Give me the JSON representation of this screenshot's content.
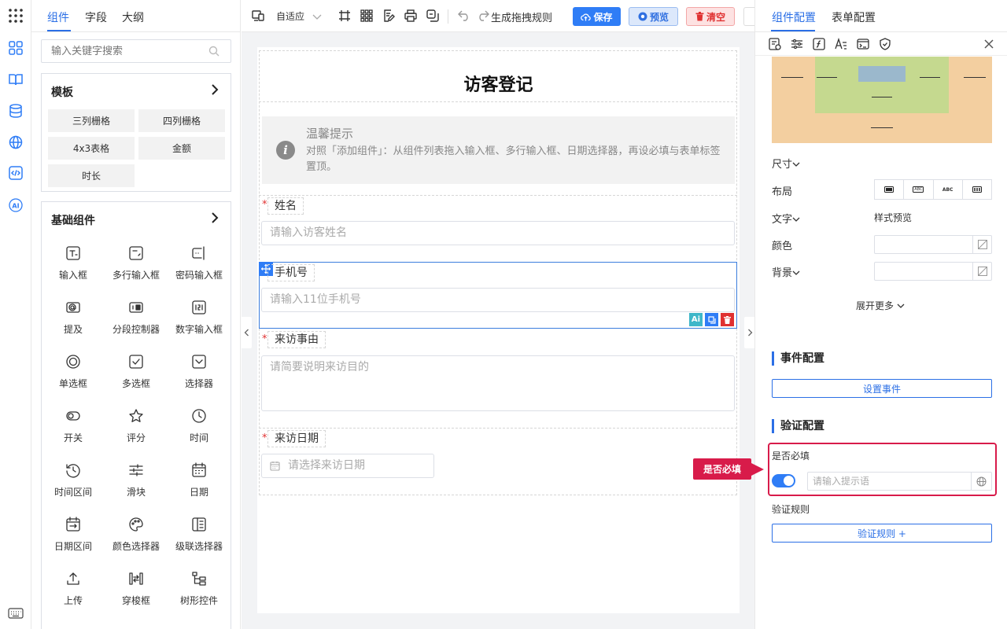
{
  "left_panel": {
    "tabs": [
      "组件",
      "字段",
      "大纲"
    ],
    "search_placeholder": "输入关键字搜索",
    "template_card": {
      "title": "模板",
      "items": [
        "三列栅格",
        "四列栅格",
        "4x3表格",
        "金额",
        "时长"
      ]
    },
    "basic_card": {
      "title": "基础组件",
      "items": [
        {
          "label": "输入框",
          "icon": "text-input-icon"
        },
        {
          "label": "多行输入框",
          "icon": "textarea-icon"
        },
        {
          "label": "密码输入框",
          "icon": "password-icon"
        },
        {
          "label": "提及",
          "icon": "mention-icon"
        },
        {
          "label": "分段控制器",
          "icon": "segmented-icon"
        },
        {
          "label": "数字输入框",
          "icon": "number-input-icon"
        },
        {
          "label": "单选框",
          "icon": "radio-icon"
        },
        {
          "label": "多选框",
          "icon": "checkbox-icon"
        },
        {
          "label": "选择器",
          "icon": "select-icon"
        },
        {
          "label": "开关",
          "icon": "switch-icon"
        },
        {
          "label": "评分",
          "icon": "star-icon"
        },
        {
          "label": "时间",
          "icon": "clock-icon"
        },
        {
          "label": "时间区间",
          "icon": "time-range-icon"
        },
        {
          "label": "滑块",
          "icon": "slider-icon"
        },
        {
          "label": "日期",
          "icon": "calendar-icon"
        },
        {
          "label": "日期区间",
          "icon": "date-range-icon"
        },
        {
          "label": "颜色选择器",
          "icon": "palette-icon"
        },
        {
          "label": "级联选择器",
          "icon": "cascader-icon"
        },
        {
          "label": "上传",
          "icon": "upload-icon"
        },
        {
          "label": "穿梭框",
          "icon": "transfer-icon"
        },
        {
          "label": "树形控件",
          "icon": "tree-icon"
        }
      ]
    }
  },
  "toolbar": {
    "device_label": "自适应",
    "generate_label": "生成拖拽规则",
    "save_label": "保存",
    "preview_label": "预览",
    "clear_label": "清空"
  },
  "form": {
    "title": "访客登记",
    "tip_title": "温馨提示",
    "tip_body": "对照「添加组件」：从组件列表拖入输入框、多行输入框、日期选择器，再设必填与表单标签置顶。",
    "fields": [
      {
        "label": "姓名",
        "placeholder": "请输入访客姓名",
        "required": "*"
      },
      {
        "label": "手机号",
        "placeholder": "请输入11位手机号"
      },
      {
        "label": "来访事由",
        "placeholder": "请简要说明来访目的",
        "required": "*"
      },
      {
        "label": "来访日期",
        "placeholder": "请选择来访日期",
        "required": "*"
      }
    ],
    "ai_badge": "Ai"
  },
  "right_panel": {
    "tabs": [
      "组件配置",
      "表单配置"
    ],
    "size_label": "尺寸",
    "layout_label": "布局",
    "layout_options": [
      "",
      "ABC",
      "ABC",
      ""
    ],
    "text_label": "文字",
    "style_preview_label": "样式预览",
    "color_label": "颜色",
    "bg_label": "背景",
    "expand_label": "展开更多",
    "event_section": "事件配置",
    "set_event_label": "设置事件",
    "validate_section": "验证配置",
    "required_label": "是否必填",
    "hint_placeholder": "请输入提示语",
    "rules_label": "验证规则",
    "rules_btn": "验证规则 +"
  },
  "callout": "是否必填",
  "colors": {
    "accent": "#2f7df6",
    "danger": "#e03131",
    "highlight": "#d81b4a",
    "box_margin": "#f3cfa0",
    "box_padding": "#c5d98f",
    "box_content": "#9bb8cc"
  }
}
